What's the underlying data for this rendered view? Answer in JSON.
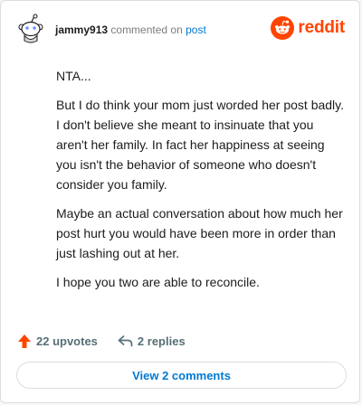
{
  "comment": {
    "username": "jammy913",
    "verb": "commented on",
    "target": "post",
    "paragraphs": [
      "NTA...",
      "But I do think your mom just worded her post badly. I don't believe she meant to insinuate that you aren't her family. In fact her happiness at seeing you isn't the behavior of someone who doesn't consider you family.",
      "Maybe an actual conversation about how much her post hurt you would have been more in order than just lashing out at her.",
      "I hope you two are able to reconcile."
    ]
  },
  "brand": {
    "wordmark": "reddit",
    "color": "#ff4500",
    "icon": "reddit-snoo-icon"
  },
  "actions": {
    "upvotes_label": "22 upvotes",
    "upvote_icon": "upvote-arrow-icon",
    "upvote_color": "#ff4500",
    "replies_label": "2 replies",
    "reply_icon": "reply-arrow-icon"
  },
  "footer": {
    "view_comments_label": "View 2 comments",
    "link_color": "#0079d3"
  },
  "avatar": {
    "icon": "snoo-avatar-icon"
  }
}
